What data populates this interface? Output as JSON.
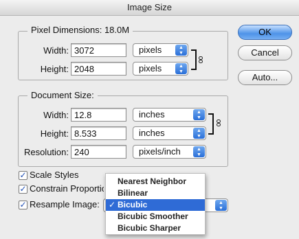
{
  "window": {
    "title": "Image Size"
  },
  "pixel_dimensions": {
    "title": "Pixel Dimensions:",
    "size": "18.0M",
    "width_label": "Width:",
    "width_value": "3072",
    "width_unit": "pixels",
    "height_label": "Height:",
    "height_value": "2048",
    "height_unit": "pixels"
  },
  "document_size": {
    "title": "Document Size:",
    "width_label": "Width:",
    "width_value": "12.8",
    "width_unit": "inches",
    "height_label": "Height:",
    "height_value": "8.533",
    "height_unit": "inches",
    "resolution_label": "Resolution:",
    "resolution_value": "240",
    "resolution_unit": "pixels/inch"
  },
  "buttons": {
    "ok": "OK",
    "cancel": "Cancel",
    "auto": "Auto..."
  },
  "options": {
    "scale_styles": {
      "label": "Scale Styles",
      "checked": true
    },
    "constrain": {
      "label": "Constrain Proportions",
      "checked": true
    },
    "resample": {
      "label": "Resample Image:",
      "checked": true
    }
  },
  "resample_menu": {
    "items": [
      "Nearest Neighbor",
      "Bilinear",
      "Bicubic",
      "Bicubic Smoother",
      "Bicubic Sharper"
    ],
    "selected": "Bicubic",
    "check": "✓"
  },
  "icons": {
    "link": "chain-link-icon",
    "checkbox": "checkmark-icon"
  },
  "colors": {
    "accent": "#2f6bd6",
    "window_bg": "#ececec"
  }
}
